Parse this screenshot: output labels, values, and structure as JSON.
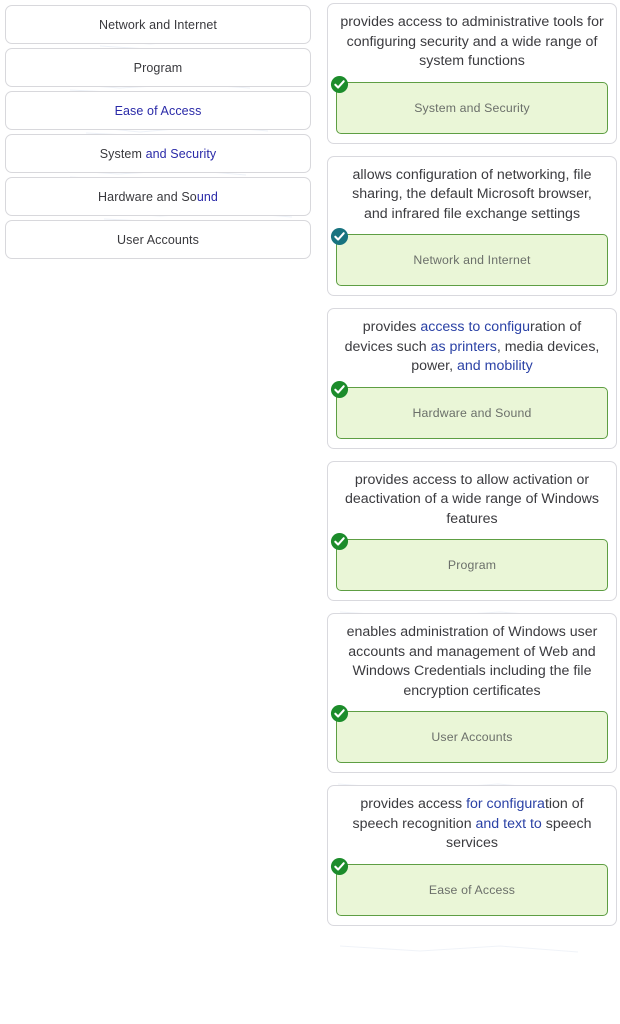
{
  "left_panel": {
    "name": "answer-options-list",
    "options": [
      {
        "label": "Network and Internet",
        "style": "plain"
      },
      {
        "label": "Program",
        "style": "plain"
      },
      {
        "label": "Ease of Access",
        "style": "blue"
      },
      {
        "label": "System and Security",
        "style": "mixed",
        "plain_part": "System ",
        "blue_part": "and Security"
      },
      {
        "label": "Hardware and Sound",
        "style": "mixed",
        "plain_part": "Hardware and So",
        "blue_part": "und"
      },
      {
        "label": "User Accounts",
        "style": "plain"
      }
    ]
  },
  "right_panel": {
    "name": "matched-pairs-list",
    "cards": [
      {
        "prompt": "provides access to administrative tools for configuring security and a wide range of system functions",
        "answer": "System and Security",
        "status_icon": "check-circle-icon",
        "status_color": "#1c8c2b"
      },
      {
        "prompt": "allows configuration of networking, file sharing, the default Microsoft browser, and infrared file exchange settings",
        "answer": "Network and Internet",
        "status_icon": "check-circle-icon",
        "status_color": "#18737f"
      },
      {
        "prompt": "provides access to configuration of devices such as printers, media devices, power, and mobility",
        "answer": "Hardware and Sound",
        "status_icon": "check-circle-icon",
        "status_color": "#1c8c2b"
      },
      {
        "prompt": "provides access to allow activation or deactivation of a wide range of Windows features",
        "answer": "Program",
        "status_icon": "check-circle-icon",
        "status_color": "#1c8c2b"
      },
      {
        "prompt": "enables administration of Windows user accounts and management of Web and Windows Credentials including the file encryption certificates",
        "answer": "User Accounts",
        "status_icon": "check-circle-icon",
        "status_color": "#1c8c2b"
      },
      {
        "prompt": "provides access for configuration of speech recognition and text to speech services",
        "answer": "Ease of Access",
        "status_icon": "check-circle-icon",
        "status_color": "#1c8c2b"
      }
    ]
  },
  "theme": {
    "answer_fill": "#eaf6d7",
    "answer_border": "#5e9e43",
    "card_border": "#d9d9de",
    "option_border": "#d8d8dc",
    "prompt_text": "#3b3b3f",
    "artifact_blue": "#2b42a6"
  }
}
